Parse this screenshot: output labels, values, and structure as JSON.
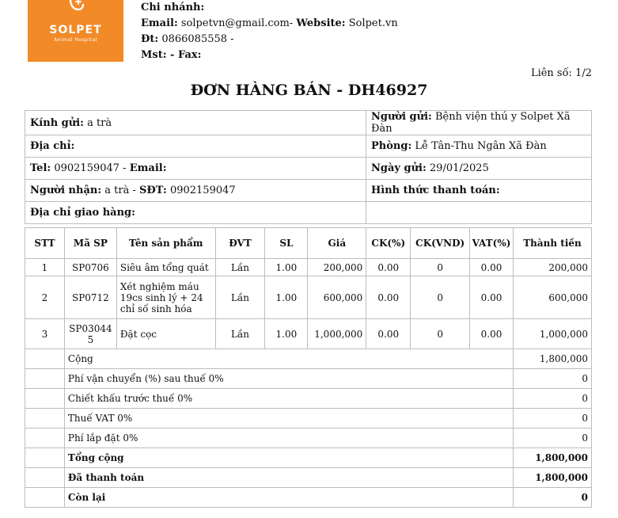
{
  "logo": {
    "brand": "SOLPET",
    "tagline": "Animal Hospital"
  },
  "company": {
    "branch_label": "Chi nhánh:",
    "email_label": "Email:",
    "email": "solpetvn@gmail.com-",
    "website_label": "Website:",
    "website": "Solpet.vn",
    "phone_label": "Đt:",
    "phone": "0866085558 -",
    "tax_fax": "Mst: - Fax:"
  },
  "copy_no": "Liên số: 1/2",
  "title": "ĐƠN HÀNG BÁN - DH46927",
  "info": {
    "to_label": "Kính gửi:",
    "to_value": "a trà",
    "sender_label": "Người gửi:",
    "sender_value": "Bệnh viện thú y Solpet Xã Đàn",
    "address_label": "Địa chỉ:",
    "address_value": "",
    "dept_label": "Phòng:",
    "dept_value": "Lễ Tân-Thu Ngân Xã Đàn",
    "tel_label": "Tel:",
    "tel_value": "0902159047 -",
    "email_label": "Email:",
    "date_label": "Ngày gửi:",
    "date_value": "29/01/2025",
    "receiver_label": "Người nhận:",
    "receiver_value": "a trà -",
    "sdt_label": "SĐT:",
    "sdt_value": "0902159047",
    "payment_label": "Hình thức thanh toán:",
    "ship_label": "Địa chỉ giao hàng:"
  },
  "table": {
    "headers": [
      "STT",
      "Mã SP",
      "Tên sản phẩm",
      "ĐVT",
      "SL",
      "Giá",
      "CK(%)",
      "CK(VND)",
      "VAT(%)",
      "Thành tiền"
    ],
    "rows": [
      {
        "stt": "1",
        "code": "SP0706",
        "name": "Siêu âm tổng quát",
        "unit": "Lần",
        "qty": "1.00",
        "price": "200,000",
        "ck_pct": "0.00",
        "ck_vnd": "0",
        "vat": "0.00",
        "total": "200,000"
      },
      {
        "stt": "2",
        "code": "SP0712",
        "name": "Xét nghiệm máu 19cs sinh lý + 24 chỉ số sinh hóa",
        "unit": "Lần",
        "qty": "1.00",
        "price": "600,000",
        "ck_pct": "0.00",
        "ck_vnd": "0",
        "vat": "0.00",
        "total": "600,000"
      },
      {
        "stt": "3",
        "code": "SP030445",
        "name": "Đặt cọc",
        "unit": "Lần",
        "qty": "1.00",
        "price": "1,000,000",
        "ck_pct": "0.00",
        "ck_vnd": "0",
        "vat": "0.00",
        "total": "1,000,000"
      }
    ]
  },
  "summary": [
    {
      "label": "Cộng",
      "value": "1,800,000",
      "bold": false
    },
    {
      "label": "Phí vận chuyển (%) sau thuế 0%",
      "value": "0",
      "bold": false
    },
    {
      "label": "Chiết khấu trước thuế 0%",
      "value": "0",
      "bold": false
    },
    {
      "label": "Thuế VAT 0%",
      "value": "0",
      "bold": false
    },
    {
      "label": "Phí lắp đặt 0%",
      "value": "0",
      "bold": false
    },
    {
      "label": "Tổng cộng",
      "value": "1,800,000",
      "bold": true
    },
    {
      "label": "Đã thanh toán",
      "value": "1,800,000",
      "bold": true
    },
    {
      "label": "Còn lại",
      "value": "0",
      "bold": true
    }
  ]
}
